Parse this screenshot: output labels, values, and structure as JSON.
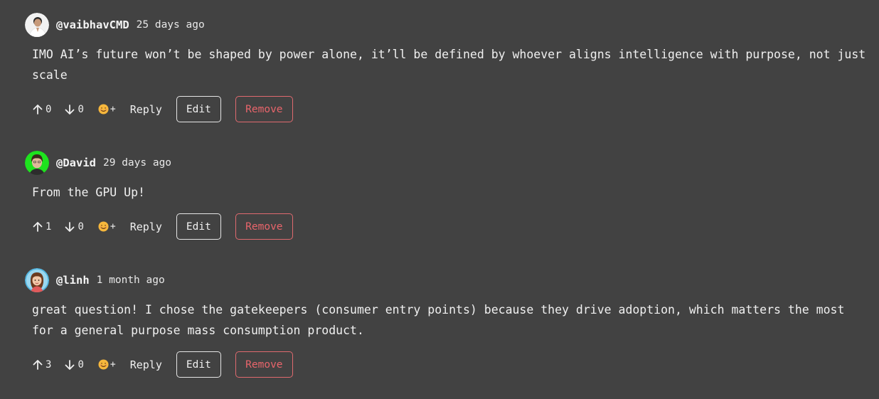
{
  "comments": [
    {
      "username": "@vaibhavCMD",
      "time": "25 days ago",
      "text": "IMO AI’s future won’t be shaped by power alone, it’ll be defined by whoever aligns intelligence with purpose, not just scale",
      "upvotes": "0",
      "downvotes": "0",
      "avatar_icon": "avatar-vaibhav-icon"
    },
    {
      "username": "@David",
      "time": "29 days ago",
      "text": "From the GPU Up!",
      "upvotes": "1",
      "downvotes": "0",
      "avatar_icon": "avatar-david-icon"
    },
    {
      "username": "@linh",
      "time": "1 month ago",
      "text": "great question! I chose the gatekeepers (consumer entry points) because they drive adoption, which matters the most for a general purpose mass consumption product.",
      "upvotes": "3",
      "downvotes": "0",
      "avatar_icon": "avatar-linh-icon"
    }
  ],
  "labels": {
    "plus": "+",
    "reply": "Reply",
    "edit": "Edit",
    "remove": "Remove"
  },
  "colors": {
    "background": "#424242",
    "remove_accent": "#e8656b"
  }
}
